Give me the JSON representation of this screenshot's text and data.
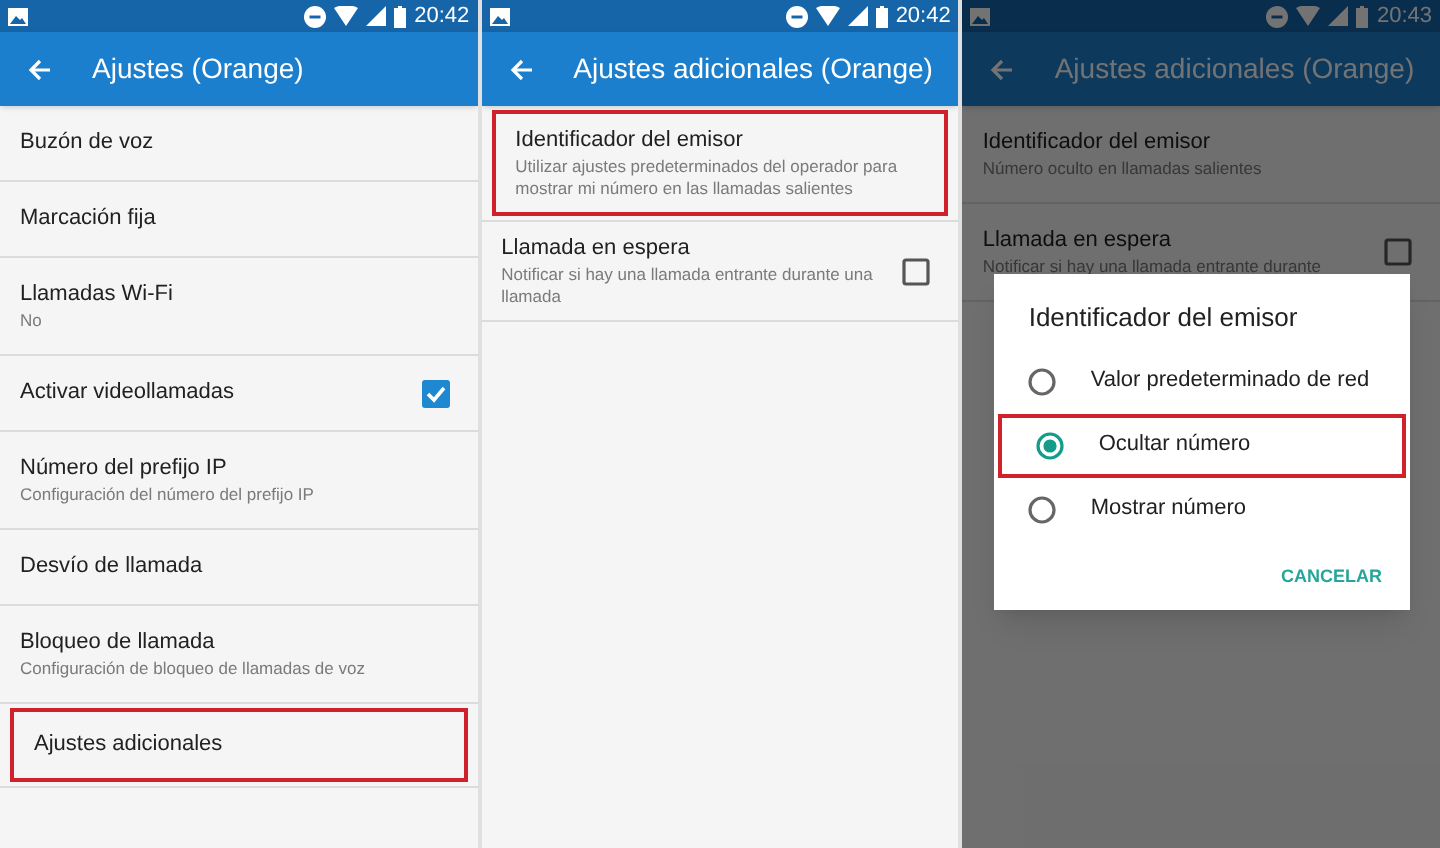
{
  "screens": [
    {
      "status_time": "20:42",
      "title": "Ajustes (Orange)",
      "dimmed": false,
      "items": [
        {
          "kind": "plain",
          "title": "Buzón de voz",
          "highlighted": false
        },
        {
          "kind": "plain",
          "title": "Marcación fija",
          "highlighted": false
        },
        {
          "kind": "plain",
          "title": "Llamadas Wi-Fi",
          "subtitle": "No",
          "highlighted": false
        },
        {
          "kind": "checkbox",
          "title": "Activar videollamadas",
          "checked": true,
          "highlighted": false
        },
        {
          "kind": "plain",
          "title": "Número del prefijo IP",
          "subtitle": "Configuración del número del prefijo IP",
          "highlighted": false
        },
        {
          "kind": "plain",
          "title": "Desvío de llamada",
          "highlighted": false
        },
        {
          "kind": "plain",
          "title": "Bloqueo de llamada",
          "subtitle": "Configuración de bloqueo de llamadas de voz",
          "highlighted": false
        },
        {
          "kind": "plain",
          "title": "Ajustes adicionales",
          "highlighted": true
        }
      ]
    },
    {
      "status_time": "20:42",
      "title": "Ajustes adicionales (Orange)",
      "dimmed": false,
      "items": [
        {
          "kind": "plain",
          "title": "Identificador del emisor",
          "subtitle": "Utilizar ajustes predeterminados del operador para mostrar mi número en las llamadas salientes",
          "highlighted": true
        },
        {
          "kind": "checkbox",
          "title": "Llamada en espera",
          "subtitle": "Notificar si hay una llamada entrante durante una llamada",
          "checked": false,
          "highlighted": false
        }
      ]
    },
    {
      "status_time": "20:43",
      "title": "Ajustes adicionales (Orange)",
      "dimmed": true,
      "items": [
        {
          "kind": "plain",
          "title": "Identificador del emisor",
          "subtitle": "Número oculto en llamadas salientes",
          "highlighted": false
        },
        {
          "kind": "checkbox",
          "title": "Llamada en espera",
          "subtitle": "Notificar si hay una llamada entrante durante",
          "checked": false,
          "highlighted": false
        }
      ],
      "dialog": {
        "title": "Identificador del emisor",
        "options": [
          {
            "label": "Valor predeterminado de red",
            "selected": false,
            "highlighted": false
          },
          {
            "label": "Ocultar número",
            "selected": true,
            "highlighted": true
          },
          {
            "label": "Mostrar número",
            "selected": false,
            "highlighted": false
          }
        ],
        "button": "CANCELAR"
      }
    }
  ]
}
